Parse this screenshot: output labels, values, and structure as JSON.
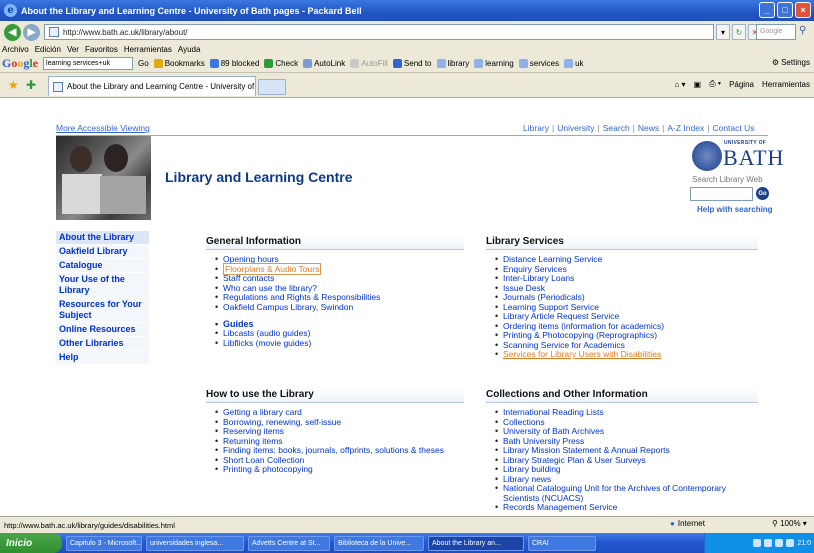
{
  "window": {
    "title": "About the Library and Learning Centre - University of Bath pages - Packard Bell",
    "minimize": "_",
    "maximize": "□",
    "close": "×"
  },
  "address_bar": {
    "url": "http://www.bath.ac.uk/library/about/",
    "search_placeholder": "Google"
  },
  "menu": [
    "Archivo",
    "Edición",
    "Ver",
    "Favoritos",
    "Herramientas",
    "Ayuda"
  ],
  "google_toolbar": {
    "search_value": "learning services+uk",
    "items": [
      "Go",
      "Bookmarks",
      "89 blocked",
      "Check",
      "AutoLink",
      "AutoFill",
      "Send to",
      "library",
      "learning",
      "services",
      "uk"
    ],
    "settings": "Settings"
  },
  "tabs": {
    "active_tab": "About the Library and Learning Centre - University of ...",
    "commands": [
      "Página",
      "Herramientas"
    ]
  },
  "page": {
    "accessible_link": "More Accessible Viewing",
    "top_links": [
      "Library",
      "University",
      "Search",
      "News",
      "A-Z Index",
      "Contact Us"
    ],
    "title": "Library and Learning Centre",
    "logo_university": "UNIVERSITY OF",
    "logo_bath": "BATH",
    "search_label": "Search Library Web",
    "search_go": "Go",
    "help_link": "Help with searching",
    "left_nav": [
      "About the Library",
      "Oakfield Library",
      "Catalogue",
      "Your Use of the Library",
      "Resources for Your Subject",
      "Online Resources",
      "Other Libraries",
      "Help"
    ],
    "general_info": {
      "heading": "General Information",
      "items": [
        "Opening hours",
        "Floorplans & Audio Tours",
        "Staff contacts",
        "Who can use the library?",
        "Regulations and Rights & Responsibilities",
        "Oakfield Campus Library, Swindon"
      ],
      "guides_items": [
        "Guides",
        "Libcasts (audio guides)",
        "Libflicks (movie guides)"
      ]
    },
    "how_to": {
      "heading": "How to use the Library",
      "items": [
        "Getting a library card",
        "Borrowing, renewing, self-issue",
        "Reserving items",
        "Returning items",
        "Finding items: books, journals, offprints, solutions & theses",
        "Short Loan Collection",
        "Printing & photocopying"
      ]
    },
    "services": {
      "heading": "Library Services",
      "items": [
        "Distance Learning Service",
        "Enquiry Services",
        "Inter-Library Loans",
        "Issue Desk",
        "Journals (Periodicals)",
        "Learning Support Service",
        "Library Article Request Service",
        "Ordering items (information for academics)",
        "Printing & Photocopying (Reprographics)",
        "Scanning Service for Academics",
        "Services for Library Users with Disabilities"
      ]
    },
    "collections": {
      "heading": "Collections and Other Information",
      "items": [
        "International Reading Lists",
        "Collections",
        "University of Bath Archives",
        "Bath University Press",
        "Library Mission Statement & Annual Reports",
        "Library Strategic Plan & User Surveys",
        "Library building",
        "Library news",
        "National Cataloguing Unit for the Archives of Contemporary Scientists (NCUACS)",
        "Records Management Service"
      ]
    }
  },
  "status_bar": {
    "url": "http://www.bath.ac.uk/library/guides/disabilities.html",
    "zone": "Internet",
    "zoom": "100%"
  },
  "taskbar": {
    "start": "Inicio",
    "tasks": [
      "Capitulo 3 - Microsoft...",
      "universidades inglesa...",
      "Advetts Centre at St...",
      "Biblioteca de la Unive...",
      "About the Library an...",
      "CRAI"
    ],
    "clock": "21:0"
  }
}
